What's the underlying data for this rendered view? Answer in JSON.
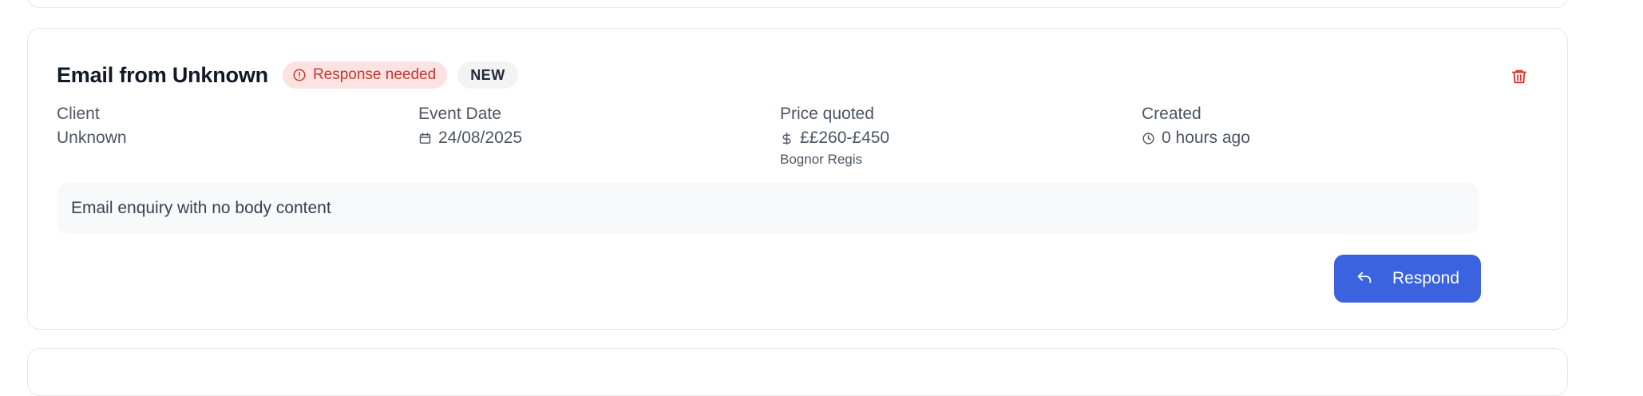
{
  "card": {
    "title": "Email from Unknown",
    "status_badge": "Response needed",
    "new_badge": "NEW",
    "fields": {
      "client": {
        "label": "Client",
        "value": "Unknown"
      },
      "event_date": {
        "label": "Event Date",
        "value": "24/08/2025"
      },
      "price": {
        "label": "Price quoted",
        "value": "££260-£450",
        "location": "Bognor Regis"
      },
      "created": {
        "label": "Created",
        "value": "0 hours ago"
      }
    },
    "body": "Email enquiry with no body content",
    "respond_label": "Respond"
  },
  "colors": {
    "accent": "#3b63e0",
    "alert_bg": "#fde2e2",
    "alert_text": "#c0392b",
    "delete": "#d9342b"
  },
  "icons": {
    "status": "alert-circle-icon",
    "delete": "trash-icon",
    "event_date": "calendar-icon",
    "price": "dollar-icon",
    "created": "clock-icon",
    "respond": "reply-icon"
  }
}
